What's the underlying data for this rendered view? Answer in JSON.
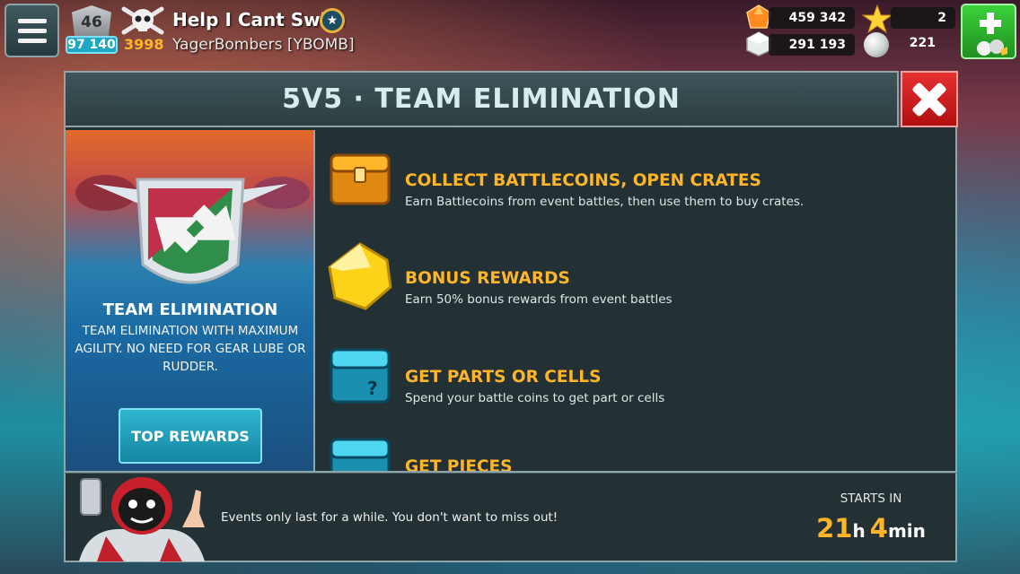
{
  "header": {
    "rank_level": "46",
    "trophies": "97 140",
    "gold": "3998",
    "player_name": "Help I Cant Swim",
    "clan": "YagerBombers [YBOMB]"
  },
  "resources": {
    "gems": "459 342",
    "stars": "2",
    "silver": "291 193",
    "pearls": "221"
  },
  "panel": {
    "title": "5V5 · TEAM ELIMINATION"
  },
  "event_card": {
    "title": "TEAM ELIMINATION",
    "description": "TEAM ELIMINATION WITH MAXIMUM AGILITY. NO NEED FOR GEAR LUBE OR RUDDER.",
    "button_label": "TOP REWARDS"
  },
  "rewards": [
    {
      "title": "COLLECT BATTLECOINS, OPEN CRATES",
      "description": "Earn Battlecoins from event battles, then use them to buy crates.",
      "icon": "gold-crate-icon"
    },
    {
      "title": "BONUS REWARDS",
      "description": "Earn 50% bonus rewards from event battles",
      "icon": "gold-gem-icon"
    },
    {
      "title": "GET PARTS OR CELLS",
      "description": "Spend your battle coins to get part or cells",
      "icon": "blue-mystery-crate-icon"
    },
    {
      "title": "GET PIECES",
      "description": "",
      "icon": "blue-crate-icon"
    }
  ],
  "footer": {
    "message": "Events only last for a while. You don't want to miss out!",
    "starts_label": "STARTS IN",
    "hours": "21",
    "hours_unit": "h",
    "minutes": "4",
    "minutes_unit": "min"
  },
  "colors": {
    "accent_gold": "#ffb52a",
    "panel_bg": "#233134",
    "close_red": "#e63030",
    "button_cyan": "#1fa6c4",
    "shop_green": "#3bd13b"
  }
}
